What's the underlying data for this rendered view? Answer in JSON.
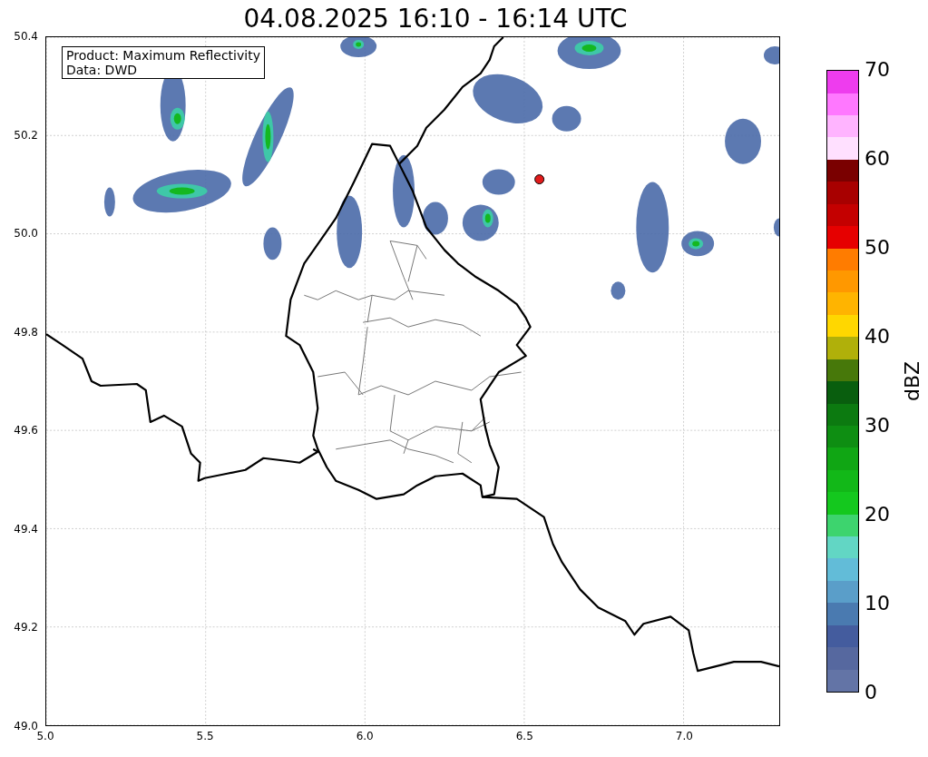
{
  "title": "04.08.2025 16:10 - 16:14 UTC",
  "info_box": {
    "lines": [
      "Product: Maximum Reflectivity",
      "Data: DWD"
    ]
  },
  "y_ticks": [
    "50.4",
    "50.2",
    "50.0",
    "49.8",
    "49.6",
    "49.4",
    "49.2",
    "49.0"
  ],
  "x_ticks": [
    "5.0",
    "5.5",
    "6.0",
    "6.5",
    "7.0"
  ],
  "colorbar": {
    "label": "dBZ",
    "ticks": [
      "70",
      "60",
      "50",
      "40",
      "30",
      "20",
      "10",
      "0"
    ],
    "bins": [
      {
        "color": "#6374a6"
      },
      {
        "color": "#56689f"
      },
      {
        "color": "#445c9e"
      },
      {
        "color": "#4a7ab0"
      },
      {
        "color": "#5a9ec9"
      },
      {
        "color": "#62bcd8"
      },
      {
        "color": "#62d6c4"
      },
      {
        "color": "#3dd46e"
      },
      {
        "color": "#14c81e"
      },
      {
        "color": "#12b818"
      },
      {
        "color": "#10a614"
      },
      {
        "color": "#0e8e12"
      },
      {
        "color": "#0c7a10"
      },
      {
        "color": "#095e0e"
      },
      {
        "color": "#47780a"
      },
      {
        "color": "#b0b00a"
      },
      {
        "color": "#ffd700"
      },
      {
        "color": "#ffb400"
      },
      {
        "color": "#ff9800"
      },
      {
        "color": "#ff7c00"
      },
      {
        "color": "#e60000"
      },
      {
        "color": "#c40000"
      },
      {
        "color": "#a80000"
      },
      {
        "color": "#7a0000"
      },
      {
        "color": "#ffe0ff"
      },
      {
        "color": "#ffb4ff"
      },
      {
        "color": "#ff78ff"
      },
      {
        "color": "#ee3cee"
      }
    ]
  }
}
